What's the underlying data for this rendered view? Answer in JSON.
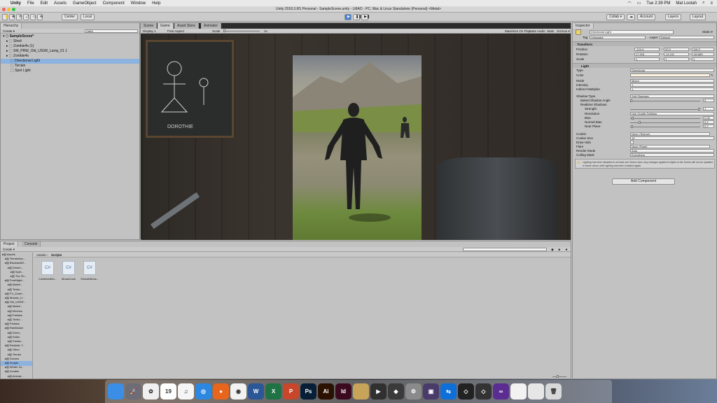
{
  "menubar": {
    "app": "Unity",
    "items": [
      "File",
      "Edit",
      "Assets",
      "GameObject",
      "Component",
      "Window",
      "Help"
    ],
    "clock": "Tue 2:39 PM",
    "user": "Mal Lootah"
  },
  "window": {
    "title": "Unity 2018.3.6f1 Personal - SampleScene.unity - LMAO - PC, Mac & Linux Standalone (Personal) <Metal>"
  },
  "toolbar": {
    "center": "Center",
    "local": "Local",
    "collab": "Collab ▾",
    "account": "Account",
    "layers": "Layers",
    "layout": "Layout"
  },
  "hierarchy": {
    "tab": "Hierarchy",
    "create": "Create ▾",
    "search_placeholder": "Q▾All",
    "scene": "SampleScene*",
    "items": [
      "Shed",
      "Zombie4s (1)",
      "SM_PRW_Old_USSR_Lamp_01 1",
      "Zombie4s",
      "Directional Light",
      "Terrain",
      "Spot Light"
    ]
  },
  "scene_tabs": [
    "Scene",
    "Game",
    "Asset Store",
    "Animator"
  ],
  "game_bar": {
    "display": "Display 1",
    "aspect": "Free Aspect",
    "scale_label": "Scale",
    "scale_value": "1x",
    "options": [
      "Maximize On Play",
      "Mute Audio",
      "Stats",
      "Gizmos ▾"
    ]
  },
  "chalk_text": "DOROTHIE",
  "project": {
    "tabs": [
      "Project",
      "Console"
    ],
    "create": "Create ▾",
    "breadcrumb": [
      "Assets",
      "Scripts"
    ],
    "tree": [
      "Assets",
      "TerrainAss...",
      "BlackandM...",
      "Desert...",
      "Sprit...",
      "The Sh...",
      "FreeNight...",
      "Materi...",
      "Textur...",
      "FX_Zomb...",
      "Mosaic_LI...",
      "Old_USSR...",
      "Materi...",
      "Meshes",
      "Prefabs",
      "Textur...",
      "Prefabs",
      "RainMaker",
      "Demo",
      "Editor",
      "Prefab...",
      "Realistic T...",
      "Other",
      "Terrain",
      "Scenes",
      "Scripts",
      "Winter Zo...",
      "Zombie",
      "Animat..."
    ],
    "files": [
      {
        "name": "CombinedMo...",
        "icon": "C#"
      },
      {
        "name": "MouseLook",
        "icon": "C#"
      },
      {
        "name": "SmoothMous...",
        "icon": "C#"
      }
    ]
  },
  "inspector": {
    "tab": "Inspector",
    "object_name": "Directional Light",
    "static_label": "Static ▾",
    "tag_label": "Tag",
    "tag_value": "Untagged",
    "layer_label": "Layer",
    "layer_value": "Default",
    "transform": {
      "title": "Transform",
      "position": {
        "label": "Position",
        "x": "-124.4",
        "y": "20.9",
        "z": "116.9"
      },
      "rotation": {
        "label": "Rotation",
        "x": "17.916",
        "y": "-14.111",
        "z": "-83.689"
      },
      "scale": {
        "label": "Scale",
        "x": "1",
        "y": "1",
        "z": "1"
      }
    },
    "light": {
      "title": "Light",
      "rows": [
        {
          "label": "Type",
          "value": "Directional"
        },
        {
          "label": "Color",
          "value": ""
        },
        {
          "label": "Mode",
          "value": "Mixed"
        },
        {
          "label": "Intensity",
          "value": "1"
        },
        {
          "label": "Indirect Multiplier",
          "value": "1"
        },
        {
          "label": "Shadow Type",
          "value": "Soft Shadows"
        },
        {
          "label": "Baked Shadow Angle",
          "value": "0"
        },
        {
          "label": "Realtime Shadows",
          "value": ""
        },
        {
          "label": "Strength",
          "value": "1"
        },
        {
          "label": "Resolution",
          "value": "Use Quality Settings"
        },
        {
          "label": "Bias",
          "value": "0.05"
        },
        {
          "label": "Normal Bias",
          "value": "0.4"
        },
        {
          "label": "Near Plane",
          "value": "0.2"
        },
        {
          "label": "Cookie",
          "value": "None (Texture)"
        },
        {
          "label": "Cookie Size",
          "value": "10"
        },
        {
          "label": "Draw Halo",
          "value": ""
        },
        {
          "label": "Flare",
          "value": "None (Flare)"
        },
        {
          "label": "Render Mode",
          "value": "Auto"
        },
        {
          "label": "Culling Mask",
          "value": "Everything"
        }
      ],
      "warning": "Lighting has been disabled in at least one Scene view. Any changes applied to lights in the Scene will not be updated in these views until Lighting has been enabled again."
    },
    "add_component": "Add Component"
  },
  "dock": [
    {
      "name": "finder-icon",
      "color": "#3a8ee6",
      "glyph": ""
    },
    {
      "name": "launchpad-icon",
      "color": "#6d6d78",
      "glyph": "🚀"
    },
    {
      "name": "photos-icon",
      "color": "#f0f0f0",
      "glyph": "✿"
    },
    {
      "name": "calendar-icon",
      "color": "#ffffff",
      "glyph": "19"
    },
    {
      "name": "itunes-icon",
      "color": "#f5f5f5",
      "glyph": "♫"
    },
    {
      "name": "safari-icon",
      "color": "#2c87e0",
      "glyph": "◎"
    },
    {
      "name": "firefox-icon",
      "color": "#e8651c",
      "glyph": "●"
    },
    {
      "name": "chrome-icon",
      "color": "#f2f2f2",
      "glyph": "◉"
    },
    {
      "name": "word-icon",
      "color": "#2b5797",
      "glyph": "W"
    },
    {
      "name": "excel-icon",
      "color": "#1f7244",
      "glyph": "X"
    },
    {
      "name": "powerpoint-icon",
      "color": "#c8472a",
      "glyph": "P"
    },
    {
      "name": "photoshop-icon",
      "color": "#071f36",
      "glyph": "Ps"
    },
    {
      "name": "illustrator-icon",
      "color": "#2b1100",
      "glyph": "Ai"
    },
    {
      "name": "indesign-icon",
      "color": "#3c0a1f",
      "glyph": "Id"
    },
    {
      "name": "notes-icon",
      "color": "#c8a35a",
      "glyph": ""
    },
    {
      "name": "finalcut-icon",
      "color": "#303030",
      "glyph": "▶"
    },
    {
      "name": "logic-icon",
      "color": "#3a3a3a",
      "glyph": "◆"
    },
    {
      "name": "system-prefs-icon",
      "color": "#8a8a8a",
      "glyph": "⚙"
    },
    {
      "name": "media-icon",
      "color": "#4a3b6b",
      "glyph": "▣"
    },
    {
      "name": "teamviewer-icon",
      "color": "#0e6fd8",
      "glyph": "⇆"
    },
    {
      "name": "unity-icon",
      "color": "#222222",
      "glyph": "◇"
    },
    {
      "name": "unity-hub-icon",
      "color": "#333333",
      "glyph": "◇"
    },
    {
      "name": "visual-studio-icon",
      "color": "#5c2d91",
      "glyph": "∞"
    },
    {
      "name": "document-icon",
      "color": "#f2f2f2",
      "glyph": ""
    },
    {
      "name": "preview-icon",
      "color": "#e6e6e6",
      "glyph": ""
    },
    {
      "name": "trash-icon",
      "color": "#d8d8d8",
      "glyph": "🗑"
    }
  ]
}
